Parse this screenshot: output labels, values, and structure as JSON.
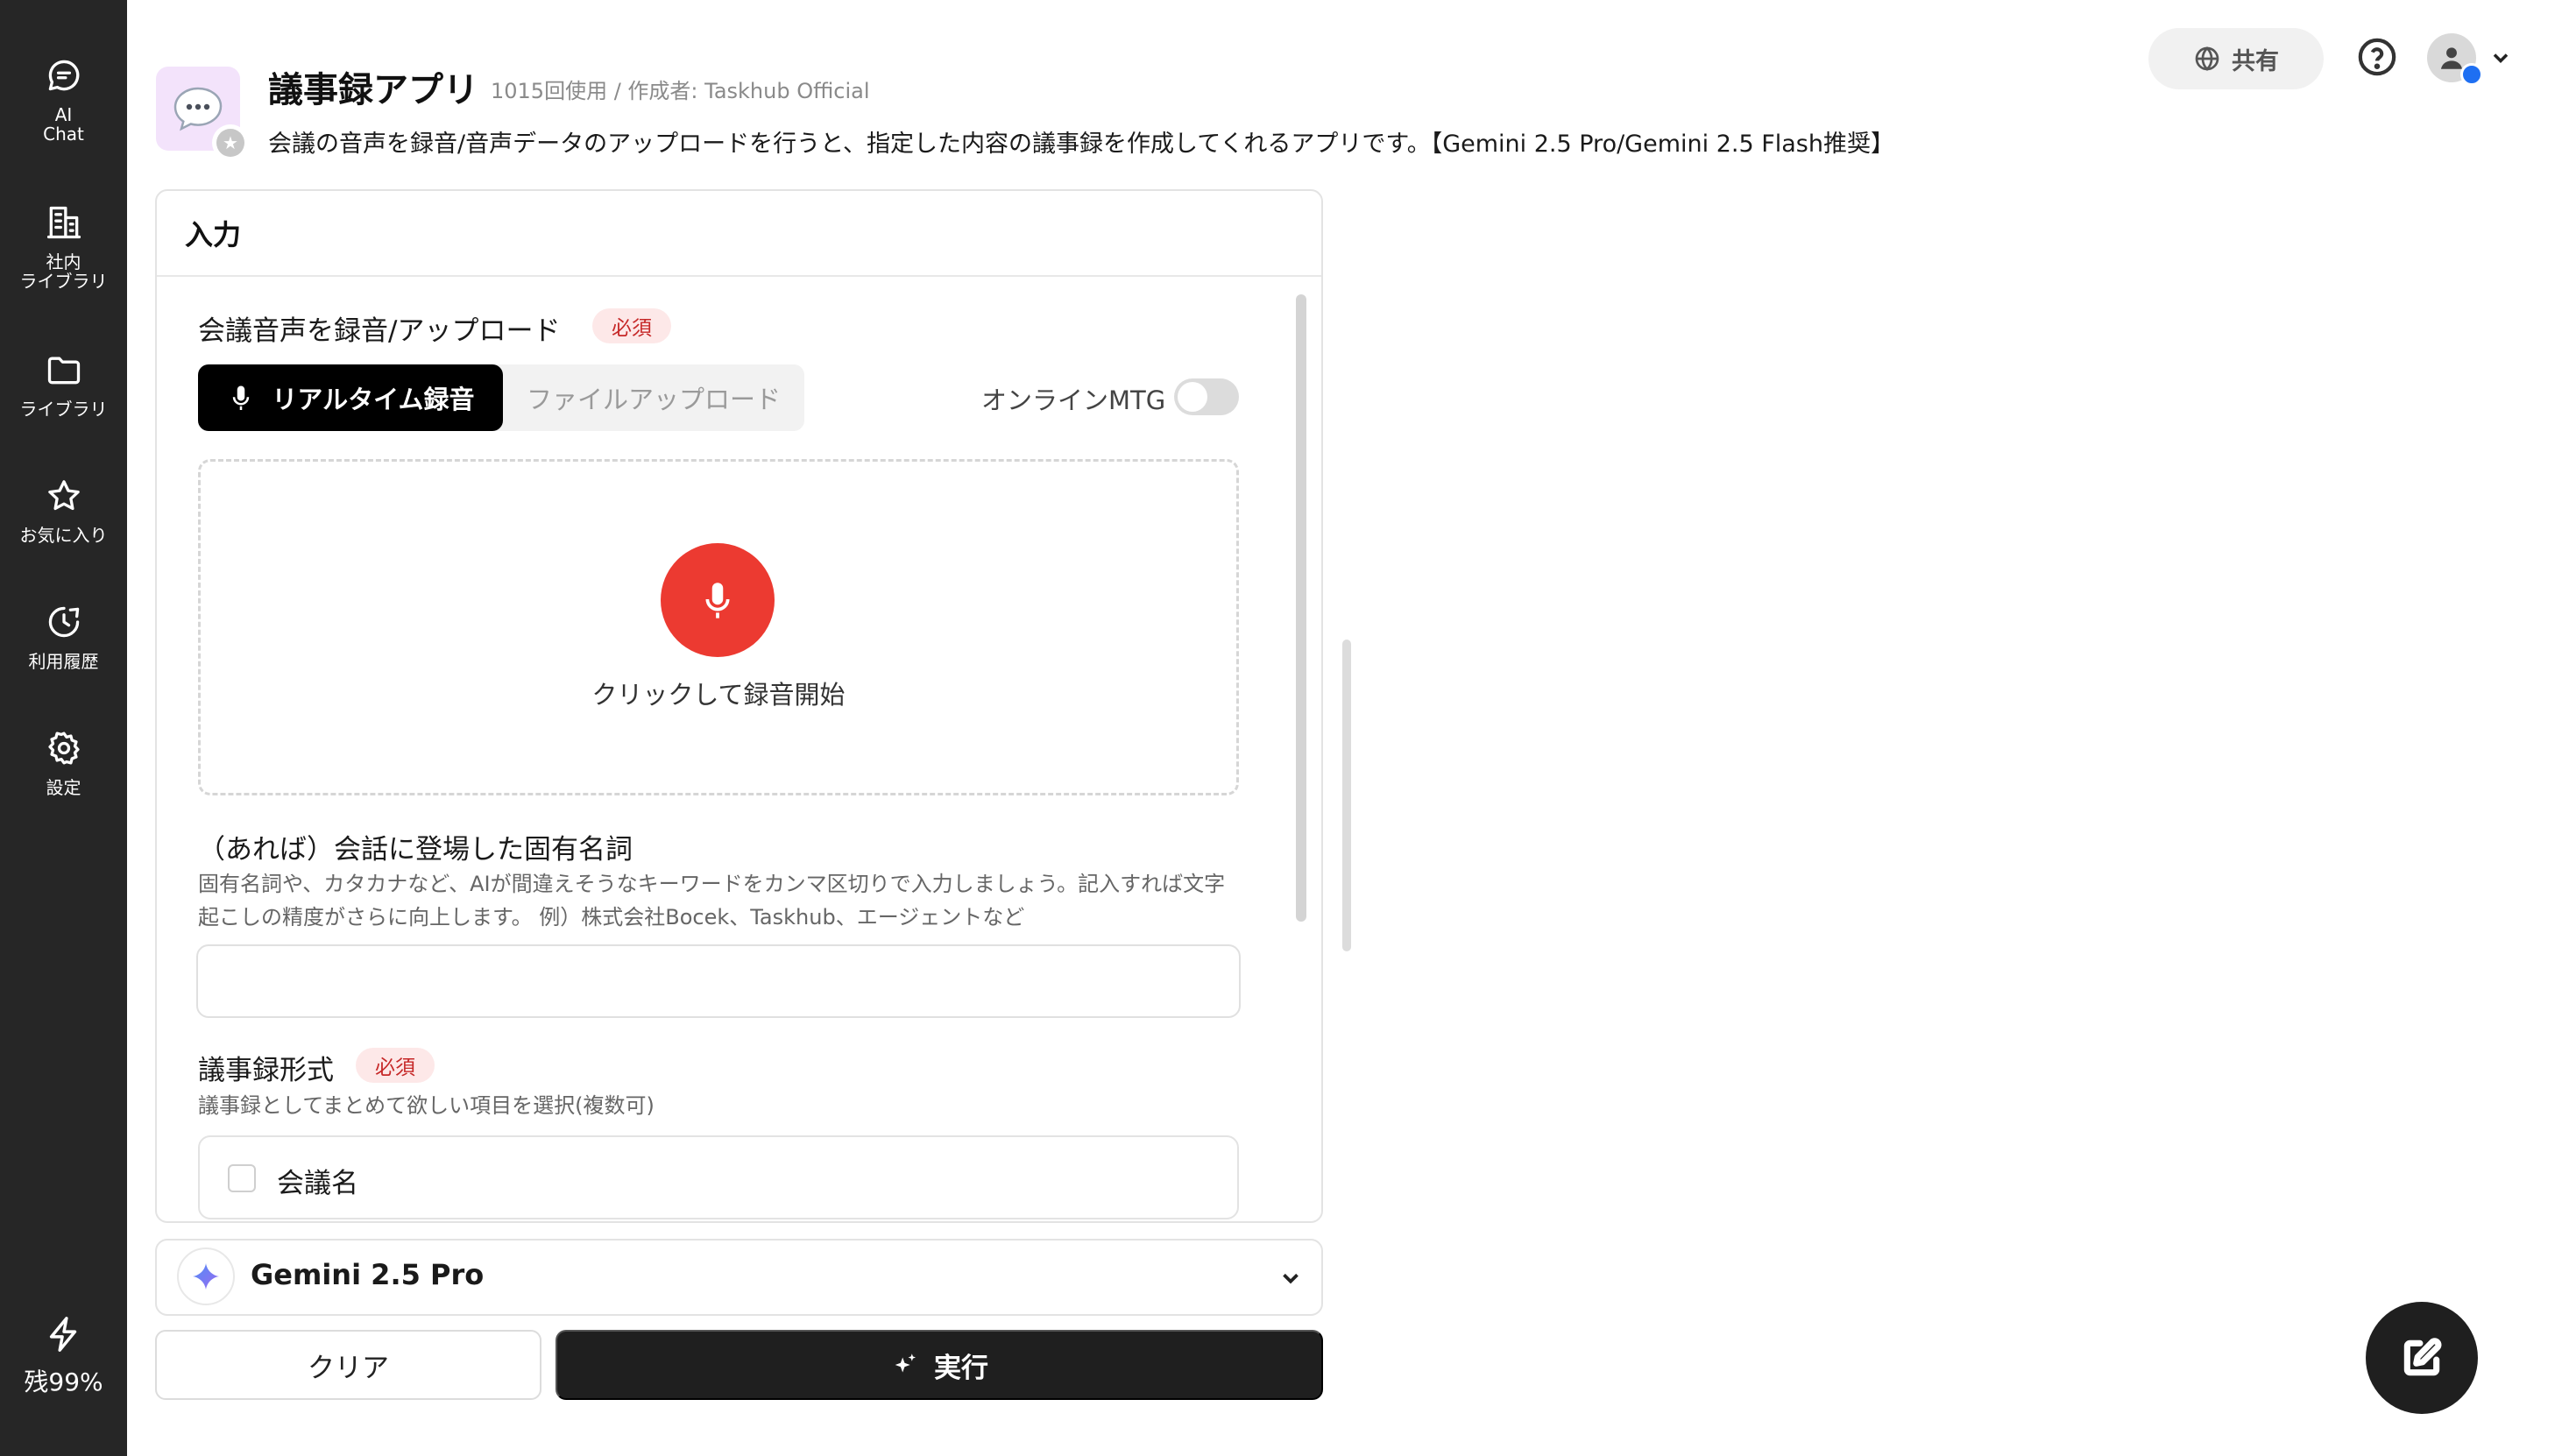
{
  "sidebar": {
    "items": [
      {
        "label": "AI\nChat",
        "icon": "chat-icon"
      },
      {
        "label": "社内\nライブラリ",
        "icon": "building-icon"
      },
      {
        "label": "ライブラリ",
        "icon": "folder-icon"
      },
      {
        "label": "お気に入り",
        "icon": "star-icon"
      },
      {
        "label": "利用履歴",
        "icon": "history-icon"
      },
      {
        "label": "設定",
        "icon": "gear-icon"
      }
    ],
    "credit_label": "残99%"
  },
  "header": {
    "title": "議事録アプリ",
    "meta": "1015回使用 / 作成者: Taskhub Official",
    "description": "会議の音声を録音/音声データのアップロードを行うと、指定した内容の議事録を作成してくれるアプリです。【Gemini 2.5 Pro/Gemini 2.5 Flash推奨】",
    "share_label": "共有"
  },
  "input_panel": {
    "heading": "入力",
    "audio_field": {
      "label": "会議音声を録音/アップロード",
      "required_badge": "必須",
      "tab_realtime": "リアルタイム録音",
      "tab_upload": "ファイルアップロード",
      "online_toggle_label": "オンラインMTG",
      "online_toggle_on": false,
      "record_caption": "クリックして録音開始"
    },
    "proper_nouns_field": {
      "label": "（あれば）会話に登場した固有名詞",
      "help": "固有名詞や、カタカナなど、AIが間違えそうなキーワードをカンマ区切りで入力しましょう。記入すれば文字起こしの精度がさらに向上します。 例）株式会社Bocek、Taskhub、エージェントなど",
      "value": ""
    },
    "format_field": {
      "label": "議事録形式",
      "required_badge": "必須",
      "help": "議事録としてまとめて欲しい項目を選択(複数可)",
      "options": [
        {
          "label": "会議名",
          "checked": false
        }
      ]
    }
  },
  "model_selector": {
    "label": "Gemini 2.5 Pro"
  },
  "actions": {
    "clear_label": "クリア",
    "run_label": "実行"
  },
  "colors": {
    "sidebar_bg": "#262626",
    "record_button": "#ec3a31",
    "required_badge_bg": "#fde8e8",
    "required_badge_text": "#c62828",
    "primary_button": "#1f1f1f"
  }
}
